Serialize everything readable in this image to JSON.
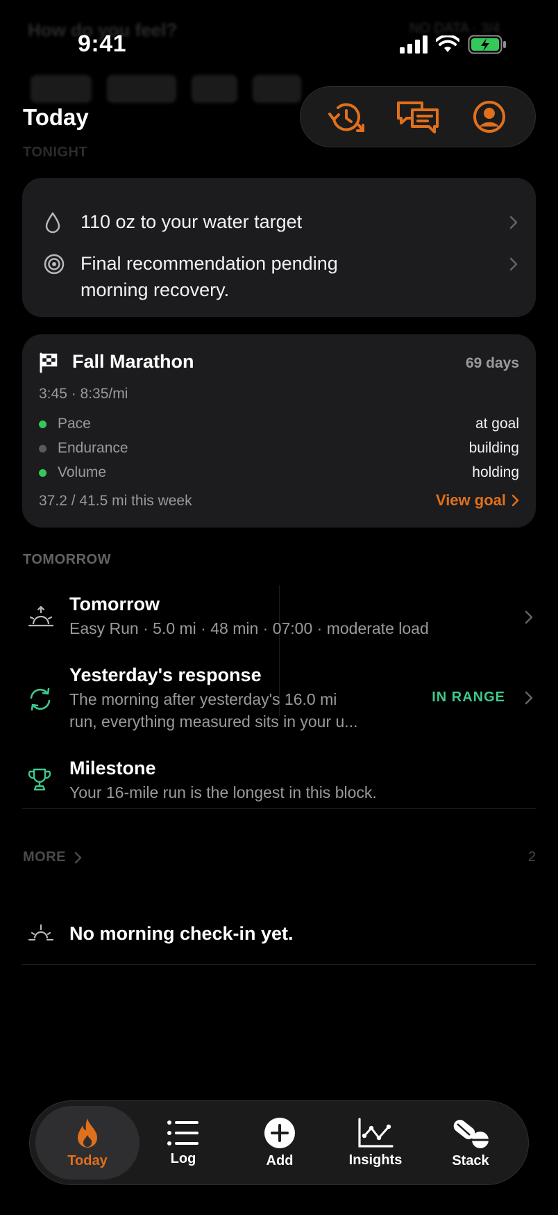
{
  "ghost": {
    "title": "How do you feel?",
    "right": "NO DATA · 3/4"
  },
  "status_bar": {
    "time": "9:41"
  },
  "header": {
    "title": "Today",
    "section_tonight": "TONIGHT"
  },
  "tonight": {
    "items": [
      {
        "icon": "droplet-icon",
        "text": "110 oz to your water target"
      },
      {
        "icon": "target-icon",
        "text_line1": "Final recommendation pending",
        "text_line2": "morning recovery."
      }
    ]
  },
  "goal": {
    "title": "Fall Marathon",
    "days": "69 days",
    "subtitle": "3:45 · 8:35/mi",
    "metrics": [
      {
        "name": "Pace",
        "value": "at goal",
        "color": "#34c759"
      },
      {
        "name": "Endurance",
        "value": "building",
        "color": "#5a5a5e"
      },
      {
        "name": "Volume",
        "value": "holding",
        "color": "#34c759"
      }
    ],
    "footer": "37.2 / 41.5 mi this week",
    "link": "View goal"
  },
  "tomorrow_section": "TOMORROW",
  "feed": [
    {
      "icon": "sunrise-icon",
      "title": "Tomorrow",
      "subtitle": "Easy Run · 5.0 mi · 48 min · 07:00 · moderate load"
    },
    {
      "icon": "refresh-icon",
      "title": "Yesterday's response",
      "subtitle_line1": "The morning after yesterday's 16.0 mi",
      "subtitle_line2": "run, everything measured sits in your u...",
      "badge": "IN RANGE"
    },
    {
      "icon": "trophy-icon",
      "title": "Milestone",
      "subtitle": "Your 16-mile run is the longest in this block."
    }
  ],
  "more": {
    "label": "MORE",
    "count": "2"
  },
  "checkin": {
    "text": "No morning check-in yet."
  },
  "tabs": [
    {
      "label": "Today",
      "icon": "flame-icon",
      "active": true
    },
    {
      "label": "Log",
      "icon": "list-icon",
      "active": false
    },
    {
      "label": "Add",
      "icon": "plus-circle-icon",
      "active": false
    },
    {
      "label": "Insights",
      "icon": "chart-icon",
      "active": false
    },
    {
      "label": "Stack",
      "icon": "pills-icon",
      "active": false
    }
  ],
  "colors": {
    "accent": "#e0701c",
    "positive": "#3ec98a",
    "card": "#1c1c1e"
  }
}
